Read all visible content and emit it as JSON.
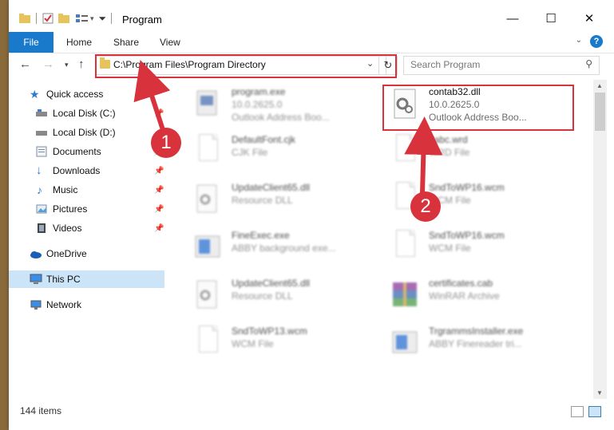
{
  "window": {
    "title": "Program"
  },
  "ribbon": {
    "tabs": [
      "File",
      "Home",
      "Share",
      "View"
    ],
    "help": "?"
  },
  "address": {
    "path": "C:\\Program Files\\Program Directory"
  },
  "search": {
    "placeholder": "Search Program"
  },
  "sidebar": {
    "items": [
      {
        "label": "Quick access",
        "icon": "star-icon"
      },
      {
        "label": "Local Disk (C:)",
        "icon": "drive-icon"
      },
      {
        "label": "Local Disk (D:)",
        "icon": "drive-icon"
      },
      {
        "label": "Documents",
        "icon": "documents-icon"
      },
      {
        "label": "Downloads",
        "icon": "download-icon"
      },
      {
        "label": "Music",
        "icon": "music-icon"
      },
      {
        "label": "Pictures",
        "icon": "pictures-icon"
      },
      {
        "label": "Videos",
        "icon": "videos-icon"
      },
      {
        "label": "OneDrive",
        "icon": "cloud-icon"
      },
      {
        "label": "This PC",
        "icon": "computer-icon"
      },
      {
        "label": "Network",
        "icon": "network-icon"
      }
    ]
  },
  "files": [
    {
      "name": "program.exe",
      "line1": "10.0.2625.0",
      "line2": "Outlook Address Boo..."
    },
    {
      "name": "contab32.dll",
      "line1": "10.0.2625.0",
      "line2": "Outlook Address Boo..."
    },
    {
      "name": "DefaultFont.cjk",
      "line1": "CJK File",
      "line2": ""
    },
    {
      "name": "Itabc.wrd",
      "line1": "WRD File",
      "line2": ""
    },
    {
      "name": "UpdateClient65.dll",
      "line1": "Resource DLL",
      "line2": ""
    },
    {
      "name": "SndToWP16.wcm",
      "line1": "WCM File",
      "line2": ""
    },
    {
      "name": "FineExec.exe",
      "line1": "ABBY background exe...",
      "line2": ""
    },
    {
      "name": "SndToWP16.wcm",
      "line1": "WCM File",
      "line2": ""
    },
    {
      "name": "UpdateClient65.dll",
      "line1": "Resource DLL",
      "line2": ""
    },
    {
      "name": "certificates.cab",
      "line1": "WinRAR Archive",
      "line2": ""
    },
    {
      "name": "SndToWP13.wcm",
      "line1": "WCM File",
      "line2": ""
    },
    {
      "name": "TrgrammsInstaller.exe",
      "line1": "ABBY Finereader tri...",
      "line2": ""
    }
  ],
  "status": {
    "count": "144 items"
  },
  "callouts": {
    "one": "1",
    "two": "2"
  },
  "colors": {
    "accent": "#1979ca",
    "highlight": "#d8323c",
    "selected": "#cce4f7"
  }
}
